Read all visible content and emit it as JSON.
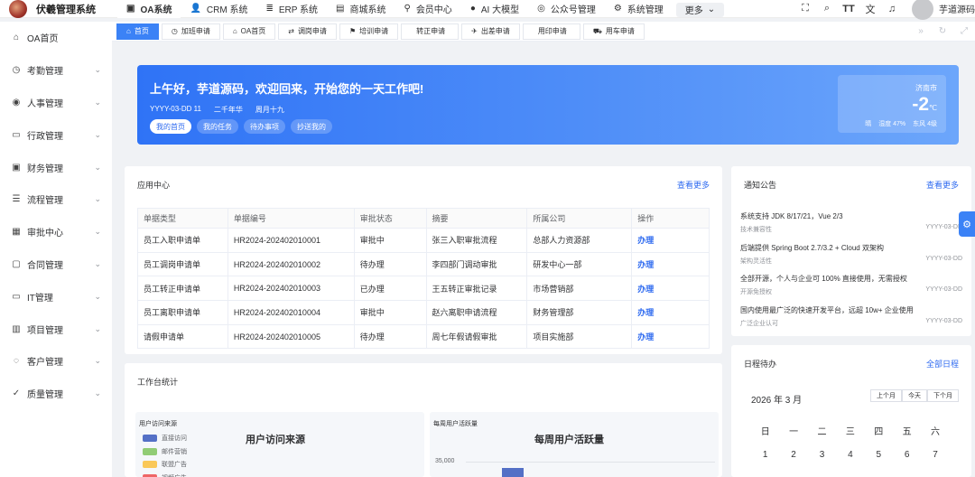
{
  "app": {
    "title": "伏羲管理系统"
  },
  "topnav": [
    {
      "icon": "grid-icon",
      "glyph": "▣",
      "label": "OA系统",
      "active": true
    },
    {
      "icon": "user-icon",
      "glyph": "👤",
      "label": "CRM 系统"
    },
    {
      "icon": "layers-icon",
      "glyph": "≣",
      "label": "ERP 系统"
    },
    {
      "icon": "shop-icon",
      "glyph": "▤",
      "label": "商城系统"
    },
    {
      "icon": "bike-icon",
      "glyph": "⚲",
      "label": "会员中心"
    },
    {
      "icon": "apple-icon",
      "glyph": "●",
      "label": "AI 大模型"
    },
    {
      "icon": "compass-icon",
      "glyph": "◎",
      "label": "公众号管理"
    },
    {
      "icon": "gear-icon",
      "glyph": "⚙",
      "label": "系统管理"
    }
  ],
  "more_label": "更多",
  "user": {
    "name": "芋道源码"
  },
  "sidebar": [
    {
      "icon": "home-icon",
      "glyph": "⌂",
      "label": "OA首页",
      "expandable": false
    },
    {
      "icon": "clock-icon",
      "glyph": "◷",
      "label": "考勤管理",
      "expandable": true
    },
    {
      "icon": "person-icon",
      "glyph": "◉",
      "label": "人事管理",
      "expandable": true
    },
    {
      "icon": "briefcase-icon",
      "glyph": "▭",
      "label": "行政管理",
      "expandable": true
    },
    {
      "icon": "finance-icon",
      "glyph": "▣",
      "label": "财务管理",
      "expandable": true
    },
    {
      "icon": "flow-icon",
      "glyph": "☰",
      "label": "流程管理",
      "expandable": true
    },
    {
      "icon": "approve-icon",
      "glyph": "▦",
      "label": "审批中心",
      "expandable": true
    },
    {
      "icon": "contract-icon",
      "glyph": "▢",
      "label": "合同管理",
      "expandable": true
    },
    {
      "icon": "monitor-icon",
      "glyph": "▭",
      "label": "IT管理",
      "expandable": true
    },
    {
      "icon": "project-icon",
      "glyph": "▥",
      "label": "项目管理",
      "expandable": true
    },
    {
      "icon": "customer-icon",
      "glyph": "◌",
      "label": "客户管理",
      "expandable": true
    },
    {
      "icon": "check-icon",
      "glyph": "✓",
      "label": "质量管理",
      "expandable": true
    }
  ],
  "tabs": [
    {
      "icon": "home-icon",
      "glyph": "⌂",
      "label": "首页",
      "active": true
    },
    {
      "icon": "clock-icon",
      "glyph": "◷",
      "label": "加班申请"
    },
    {
      "icon": "home-icon",
      "glyph": "⌂",
      "label": "OA首页"
    },
    {
      "icon": "swap-icon",
      "glyph": "⇄",
      "label": "调岗申请"
    },
    {
      "icon": "flag-icon",
      "glyph": "⚑",
      "label": "培训申请"
    },
    {
      "icon": "",
      "glyph": "",
      "label": "转正申请"
    },
    {
      "icon": "plane-icon",
      "glyph": "✈",
      "label": "出差申请"
    },
    {
      "icon": "",
      "glyph": "",
      "label": "用印申请"
    },
    {
      "icon": "car-icon",
      "glyph": "⛟",
      "label": "用车申请"
    }
  ],
  "banner": {
    "greeting": "上午好，芋道源码，欢迎回来，开始您的一天工作吧!",
    "date": "YYYY-03-DD 11",
    "lunar": "二千年华",
    "week": "周月十九",
    "buttons": [
      {
        "label": "我的首页",
        "active": true
      },
      {
        "label": "我的任务"
      },
      {
        "label": "待办事项"
      },
      {
        "label": "抄送我的"
      }
    ],
    "weather": {
      "city": "济南市",
      "temp": "-2",
      "unit": "℃",
      "condition": "晴",
      "humidity": "湿度 47%",
      "wind": "东风 4级"
    }
  },
  "app_center": {
    "title": "应用中心",
    "more": "查看更多",
    "columns": [
      "单据类型",
      "单据编号",
      "审批状态",
      "摘要",
      "所属公司",
      "操作"
    ],
    "rows": [
      [
        "员工入职申请单",
        "HR2024-202402010001",
        "审批中",
        "张三入职审批流程",
        "总部人力资源部",
        "办理"
      ],
      [
        "员工调岗申请单",
        "HR2024-202402010002",
        "待办理",
        "李四部门调动审批",
        "研发中心一部",
        "办理"
      ],
      [
        "员工转正申请单",
        "HR2024-202402010003",
        "已办理",
        "王五转正审批记录",
        "市场营销部",
        "办理"
      ],
      [
        "员工离职申请单",
        "HR2024-202402010004",
        "审批中",
        "赵六离职申请流程",
        "财务管理部",
        "办理"
      ],
      [
        "请假申请单",
        "HR2024-202402010005",
        "待办理",
        "周七年假请假审批",
        "项目实施部",
        "办理"
      ]
    ]
  },
  "notices": {
    "title": "通知公告",
    "more": "查看更多",
    "items": [
      {
        "title": "系统支持 JDK 8/17/21，Vue 2/3",
        "sub": "技术兼容性",
        "date": "YYYY-03-DD"
      },
      {
        "title": "后端提供 Spring Boot 2.7/3.2 + Cloud 双架构",
        "sub": "架构灵活性",
        "date": "YYYY-03-DD"
      },
      {
        "title": "全部开源，个人与企业可 100% 直接使用，无需授权",
        "sub": "开源免授权",
        "date": "YYYY-03-DD"
      },
      {
        "title": "国内使用最广泛的快速开发平台，远超 10w+ 企业使用",
        "sub": "广泛企业认可",
        "date": "YYYY-03-DD"
      }
    ]
  },
  "workbench": {
    "title": "工作台统计",
    "source_panel": {
      "title": "用户访问来源",
      "chart_title": "用户访问来源",
      "legend": [
        {
          "label": "直接访问",
          "color": "#5470c6"
        },
        {
          "label": "邮件营销",
          "color": "#91cc75"
        },
        {
          "label": "联盟广告",
          "color": "#fac858"
        },
        {
          "label": "视频广告",
          "color": "#ee6666"
        }
      ]
    },
    "active_panel": {
      "title": "每周用户活跃量",
      "chart_title": "每周用户活跃量",
      "ytick": "35,000",
      "bar_color": "#5470c6"
    }
  },
  "schedule": {
    "title": "日程待办",
    "more": "全部日程",
    "month": "2026 年 3 月",
    "buttons": [
      "上个月",
      "今天",
      "下个月"
    ],
    "weekdays": [
      "日",
      "一",
      "二",
      "三",
      "四",
      "五",
      "六"
    ],
    "days": [
      "1",
      "2",
      "3",
      "4",
      "5",
      "6",
      "7"
    ]
  }
}
